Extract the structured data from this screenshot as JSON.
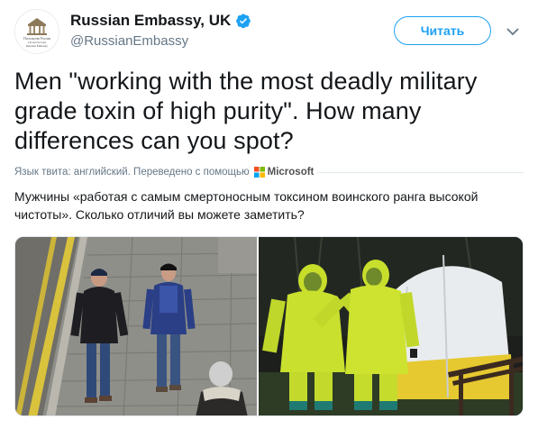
{
  "account": {
    "display_name": "Russian Embassy, UK",
    "handle": "@RussianEmbassy",
    "verified": true,
    "avatar_caption_lines": [
      "Посольство России",
      "в Великобритании",
      "Russian Embassy"
    ]
  },
  "actions": {
    "follow_label": "Читать",
    "more_icon": "chevron-down-icon"
  },
  "tweet": {
    "text": "Men \"working with the most deadly military grade toxin of high purity\". How many differences can you spot?"
  },
  "translation": {
    "meta": "Язык твита: английский. Переведено с помощью",
    "provider": "Microsoft",
    "text": "Мужчины «работая с самым смертоносным токсином воинского ранга высокой чистоты». Сколько отличий вы можете заметить?"
  },
  "media": {
    "photos": [
      {
        "subject": "cctv-street-photo"
      },
      {
        "subject": "hazmat-suits-photo"
      }
    ]
  },
  "colors": {
    "accent": "#1da1f2",
    "text": "#14171a",
    "secondary": "#657786",
    "divider": "#e1e8ed"
  }
}
